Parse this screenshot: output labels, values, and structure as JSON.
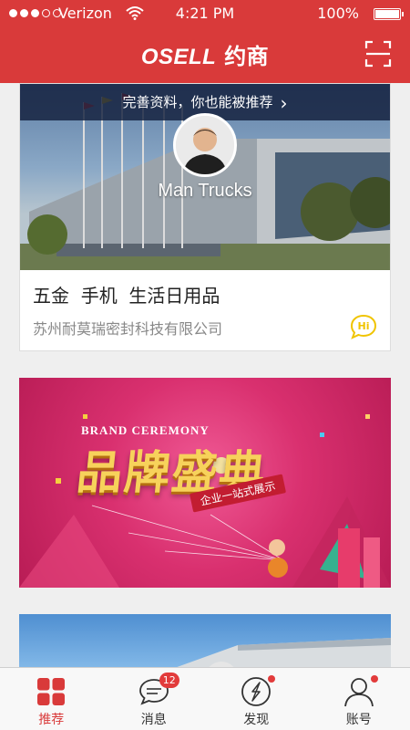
{
  "status_bar": {
    "carrier": "Verizon",
    "time": "4:21 PM",
    "battery": "100%",
    "battery_level": 1.0,
    "signal_bars_filled": 3,
    "signal_bars_total": 5
  },
  "header": {
    "logo_latin": "OSELL",
    "logo_cn": "约商",
    "scan_icon": "scan-frame-icon",
    "bg_color": "#d93a3a"
  },
  "feed": {
    "profile_card": {
      "prompt": "完善资料，你也能被推荐",
      "name": "Man Trucks",
      "tags": "五金  手机  生活日用品",
      "company": "苏州耐莫瑞密封科技有限公司",
      "hi_icon_text": "Hi"
    },
    "promo_banner": {
      "small_title": "BRAND CEREMONY",
      "main_title": "品牌盛典",
      "ribbon": "企业一站式展示"
    }
  },
  "tabbar": {
    "tabs": [
      {
        "label": "推荐",
        "icon": "grid-icon",
        "active": true
      },
      {
        "label": "消息",
        "icon": "chat-icon",
        "badge": "12"
      },
      {
        "label": "发现",
        "icon": "compass-icon",
        "dot": true
      },
      {
        "label": "账号",
        "icon": "person-icon",
        "dot": true
      }
    ],
    "accent": "#d93a3a"
  }
}
